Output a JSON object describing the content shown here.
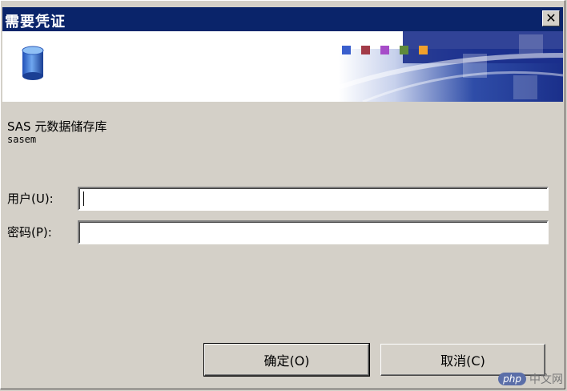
{
  "window": {
    "title": "需要凭证",
    "close_glyph": "✕"
  },
  "banner": {
    "icon": "database-cylinder-icon",
    "square_colors": [
      "#3a5fcd",
      "#a23b48",
      "#a64cc8",
      "#5f8a3c",
      "#f1a12c"
    ]
  },
  "info": {
    "repository": "SAS 元数据储存库",
    "server": "sasem"
  },
  "form": {
    "user_label": "用户(U):",
    "user_value": "",
    "password_label": "密码(P):",
    "password_value": ""
  },
  "buttons": {
    "ok_label": "确定(O)",
    "cancel_label": "取消(C)"
  },
  "watermark": {
    "badge": "php",
    "text": "中文网"
  }
}
